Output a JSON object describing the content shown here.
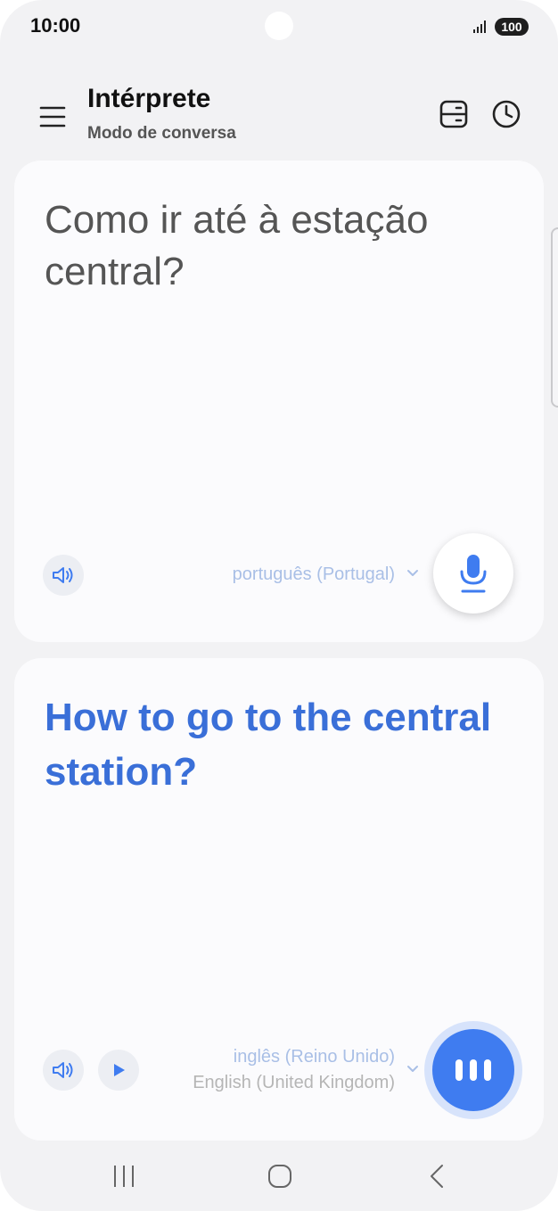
{
  "status_bar": {
    "time": "10:00",
    "battery": "100",
    "icons": [
      "signal-icon",
      "battery-icon"
    ]
  },
  "header": {
    "title": "Intérprete",
    "subtitle": "Modo de conversa",
    "icons": [
      "menu-icon",
      "layout-icon",
      "history-icon"
    ]
  },
  "source_card": {
    "text": "Como ir até à estação central?",
    "language": "português (Portugal)",
    "icons": [
      "speaker-icon",
      "chevron-down-icon",
      "microphone-icon"
    ]
  },
  "target_card": {
    "text": "How to go to the central station?",
    "language": "inglês (Reino Unido)",
    "language_native": "English (United Kingdom)",
    "icons": [
      "speaker-icon",
      "play-icon",
      "chevron-down-icon",
      "listening-bars-icon"
    ]
  },
  "navbar": {
    "icons": [
      "recent-apps-icon",
      "home-icon",
      "back-icon"
    ]
  },
  "colors": {
    "background": "#f2f2f4",
    "card": "#fbfbfd",
    "accent_blue": "#3f7cf0",
    "translation_text": "#3a6fd8",
    "language_label": "#a9bfe6"
  }
}
